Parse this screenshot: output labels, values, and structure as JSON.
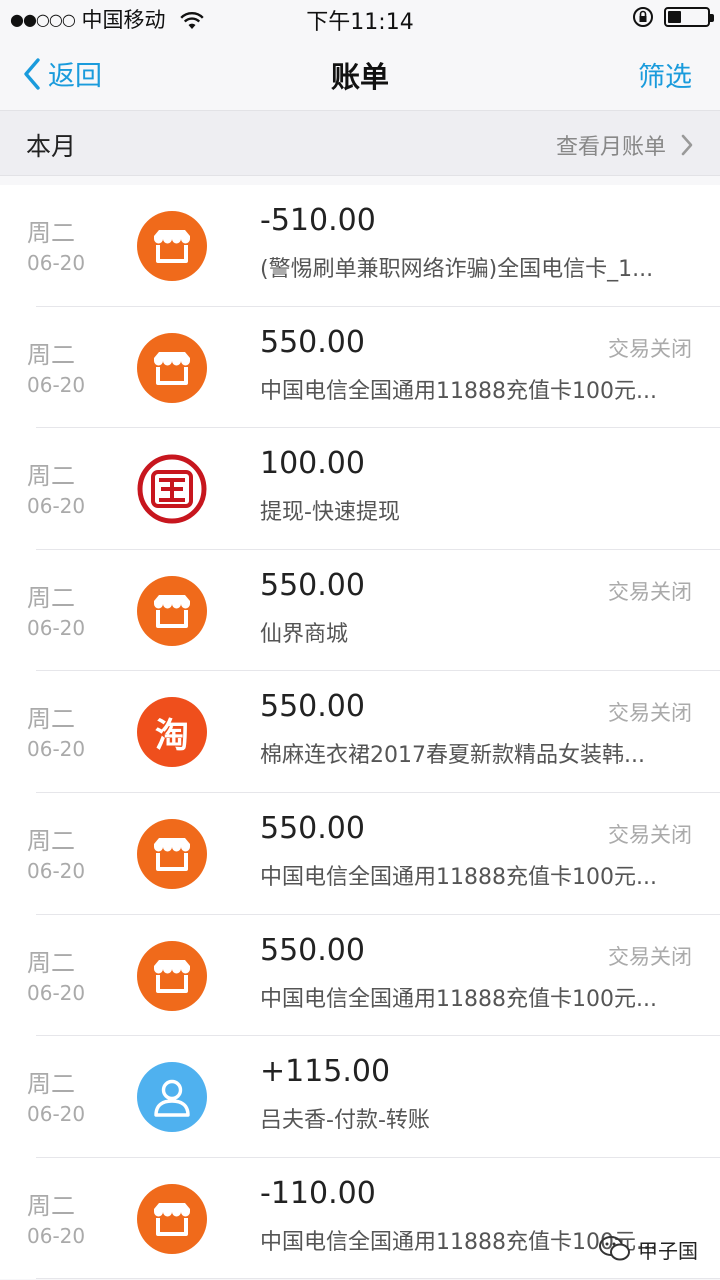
{
  "status_bar": {
    "carrier": "中国移动",
    "time": "下午11:14",
    "signal_icon": "signal-dots-icon",
    "wifi_icon": "wifi-icon",
    "lock_icon": "rotation-lock-icon",
    "battery_icon": "battery-icon",
    "battery_level": 0.35
  },
  "nav": {
    "back_label": "返回",
    "title": "账单",
    "filter_label": "筛选",
    "accent_color": "#1a9bdc"
  },
  "month_bar": {
    "label": "本月",
    "link_label": "查看月账单"
  },
  "transactions": [
    {
      "day": "周二",
      "date": "06-20",
      "icon": "shop-icon",
      "amount": "-510.00",
      "desc": "(警惕刷单兼职网络诈骗)全国电信卡_1...",
      "status": ""
    },
    {
      "day": "周二",
      "date": "06-20",
      "icon": "shop-icon",
      "amount": "550.00",
      "desc": "中国电信全国通用11888充值卡100元...",
      "status": "交易关闭"
    },
    {
      "day": "周二",
      "date": "06-20",
      "icon": "bank-icon",
      "amount": "100.00",
      "desc": "提现-快速提现",
      "status": ""
    },
    {
      "day": "周二",
      "date": "06-20",
      "icon": "shop-icon",
      "amount": "550.00",
      "desc": "仙界商城",
      "status": "交易关闭"
    },
    {
      "day": "周二",
      "date": "06-20",
      "icon": "taobao-icon",
      "amount": "550.00",
      "desc": "棉麻连衣裙2017春夏新款精品女装韩...",
      "status": "交易关闭"
    },
    {
      "day": "周二",
      "date": "06-20",
      "icon": "shop-icon",
      "amount": "550.00",
      "desc": "中国电信全国通用11888充值卡100元...",
      "status": "交易关闭"
    },
    {
      "day": "周二",
      "date": "06-20",
      "icon": "shop-icon",
      "amount": "550.00",
      "desc": "中国电信全国通用11888充值卡100元...",
      "status": "交易关闭"
    },
    {
      "day": "周二",
      "date": "06-20",
      "icon": "person-icon",
      "amount": "+115.00",
      "desc": "吕夫香-付款-转账",
      "status": ""
    },
    {
      "day": "周二",
      "date": "06-20",
      "icon": "shop-icon",
      "amount": "-110.00",
      "desc": "中国电信全国通用11888充值卡100元...",
      "status": ""
    }
  ],
  "taobao_char": "淘",
  "watermark": {
    "icon": "wechat-icon",
    "label": "甲子国"
  },
  "colors": {
    "shop_orange": "#f06a1b",
    "bank_red": "#c7161e",
    "person_blue": "#4fb1ef"
  }
}
